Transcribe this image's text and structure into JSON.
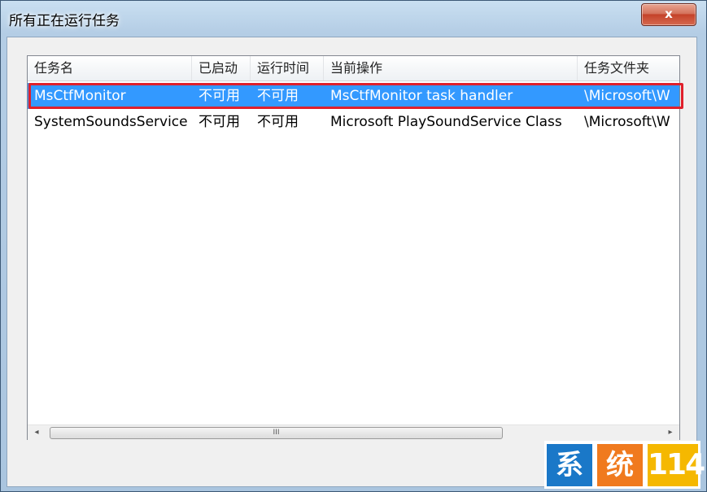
{
  "window": {
    "title": "所有正在运行任务",
    "close_glyph": "x"
  },
  "table": {
    "columns": [
      "任务名",
      "已启动",
      "运行时间",
      "当前操作",
      "任务文件夹"
    ],
    "rows": [
      {
        "name": "MsCtfMonitor",
        "started": "不可用",
        "runtime": "不可用",
        "action": "MsCtfMonitor task handler",
        "folder": "\\Microsoft\\W",
        "selected": true
      },
      {
        "name": "SystemSoundsService",
        "started": "不可用",
        "runtime": "不可用",
        "action": "Microsoft PlaySoundService Class",
        "folder": "\\Microsoft\\W",
        "selected": false
      }
    ]
  },
  "scrollbar": {
    "left_arrow": "◂",
    "right_arrow": "▸",
    "grip": "III"
  },
  "watermark": {
    "chars": [
      "系",
      "统",
      "114"
    ],
    "colors": [
      "#1a78c8",
      "#f07a1e",
      "#f5b800"
    ]
  },
  "colors": {
    "selection": "#3399ff",
    "highlight_outline": "#e0202b"
  }
}
